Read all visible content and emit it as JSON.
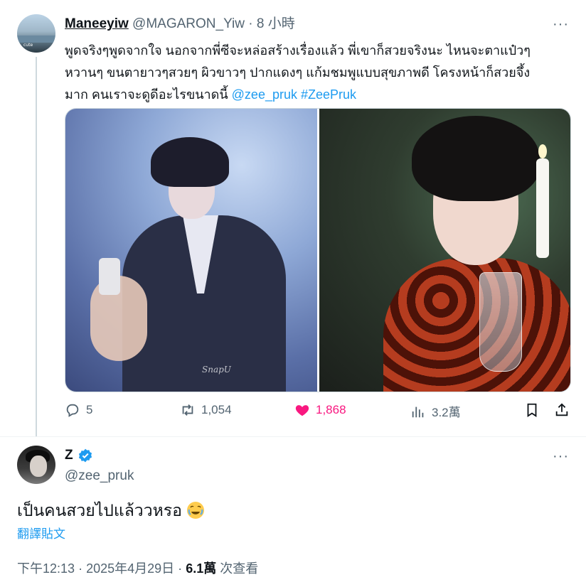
{
  "parent_tweet": {
    "author_name": "Maneeyiw",
    "handle": "@MAGARON_Yiw",
    "separator": "·",
    "time": "8 小時",
    "more": "···",
    "avatar_tag": "cute",
    "text_lines": [
      "พูดจริงๆพูดจากใจ นอกจากพี่ซีจะหล่อสร้างเรื่องแล้ว พี่เขาก็สวยจริงนะ ไหนจะตาแป๋วๆ",
      "หวานๆ ขนตายาวๆสวยๆ ผิวขาวๆ ปากแดงๆ แก้มชมพูแบบสุขภาพดี โครงหน้าก็สวยจึ้ง",
      "มาก คนเราจะดูดีอะไรขนาดนี้ "
    ],
    "mention": "@zee_pruk",
    "hashtag": "#ZeePruk",
    "photo_watermark": "SnapU",
    "stats": {
      "replies": "5",
      "retweets": "1,054",
      "likes": "1,868",
      "views": "3.2萬"
    }
  },
  "main_tweet": {
    "author_name": "Z",
    "verified": true,
    "handle": "@zee_pruk",
    "more": "···",
    "text": "เป็นคนสวยไปแล้ววหรอ",
    "translate_label": "翻譯貼文",
    "time": "下午12:13",
    "separator": "·",
    "date": "2025年4月29日",
    "views_count": "6.1萬",
    "views_label": "次查看"
  },
  "colors": {
    "text": "#0f1419",
    "secondary": "#536471",
    "link": "#1d9bf0",
    "like": "#f91880",
    "divider": "#eff3f4"
  },
  "icons": [
    "reply-icon",
    "retweet-icon",
    "heart-icon",
    "views-icon",
    "bookmark-icon",
    "share-icon",
    "verified-icon",
    "more-icon",
    "emoji-icon"
  ]
}
